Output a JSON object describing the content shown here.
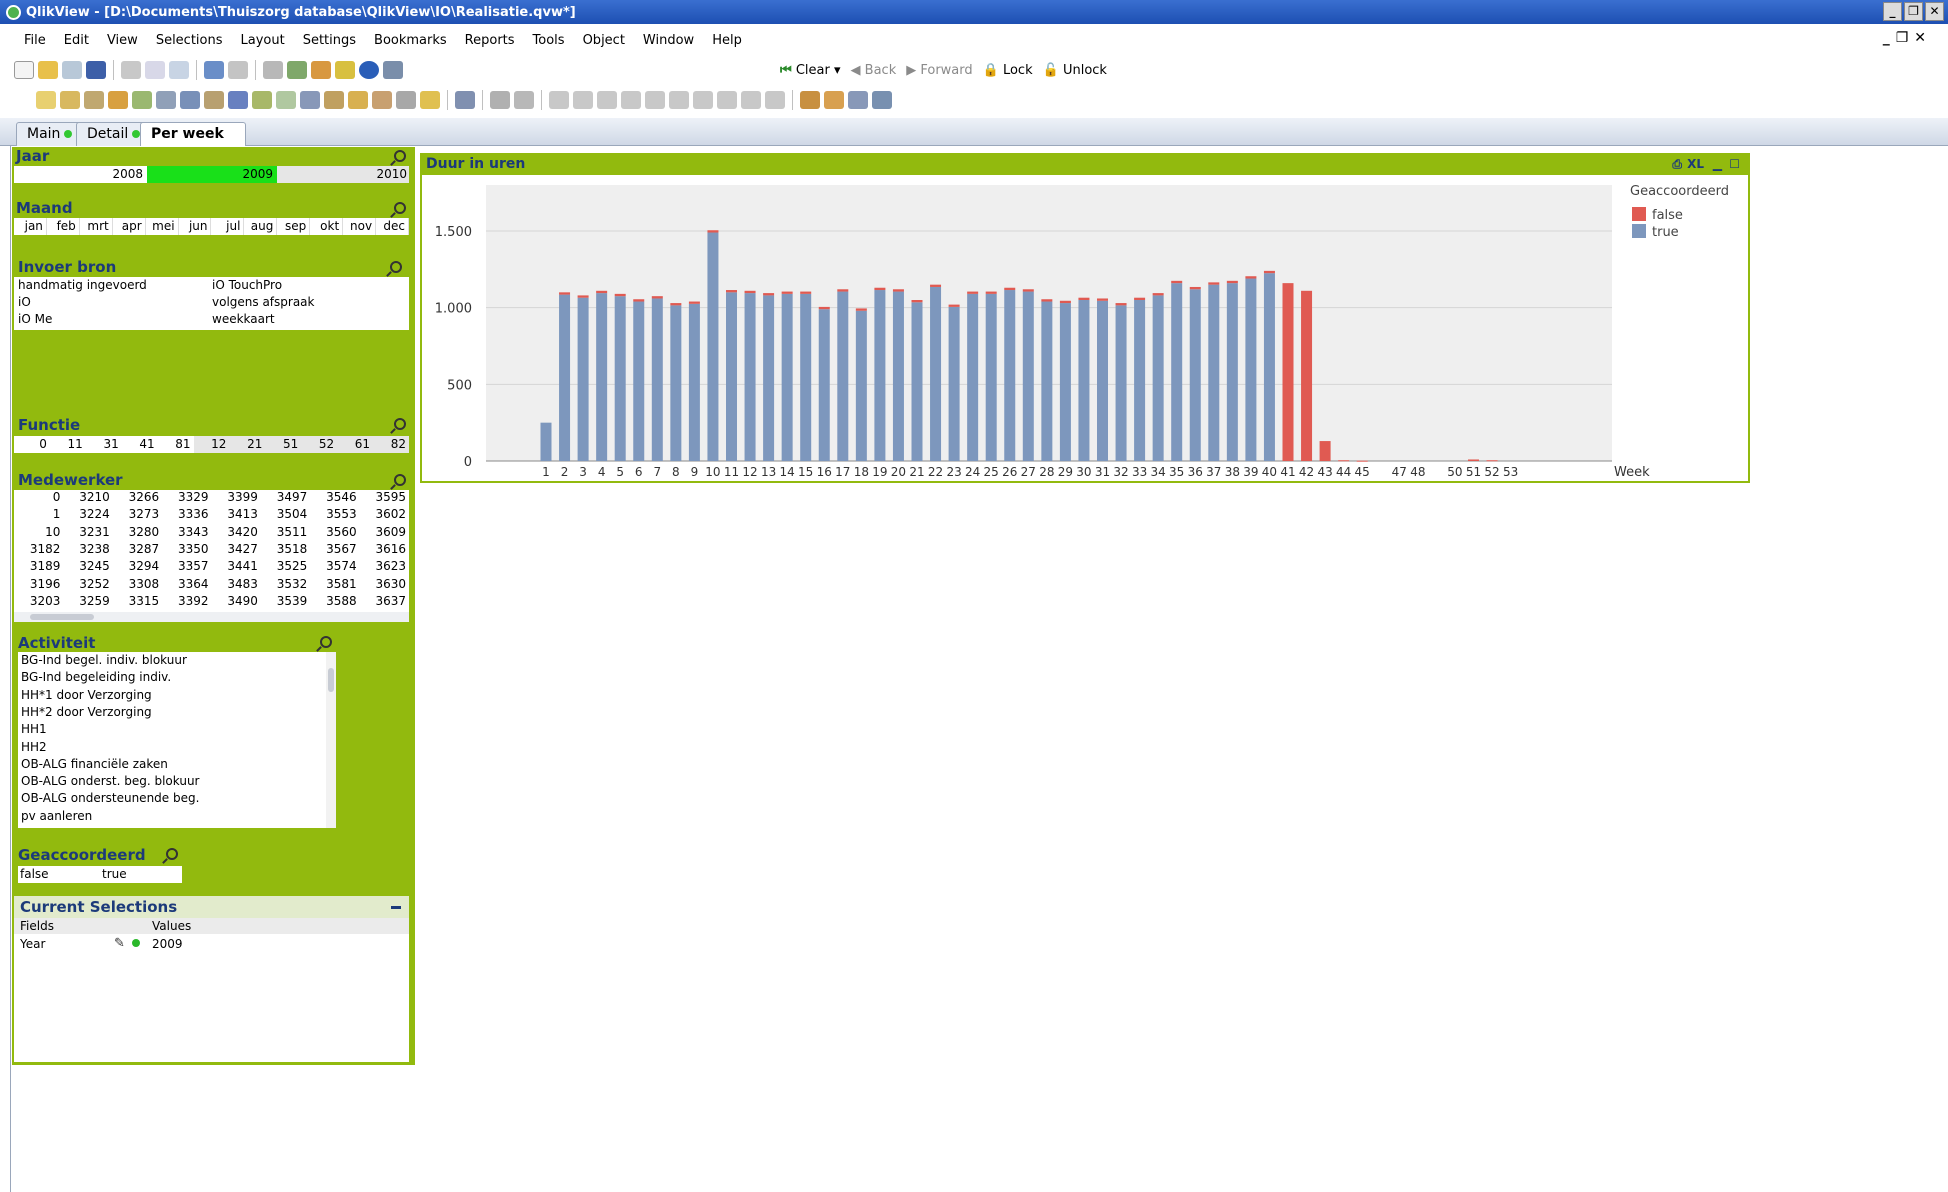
{
  "window": {
    "title": "QlikView - [D:\\Documents\\Thuiszorg database\\QlikView\\IO\\Realisatie.qvw*]"
  },
  "menu": [
    "File",
    "Edit",
    "View",
    "Selections",
    "Layout",
    "Settings",
    "Bookmarks",
    "Reports",
    "Tools",
    "Object",
    "Window",
    "Help"
  ],
  "toolbar": {
    "clear": "Clear",
    "back": "Back",
    "forward": "Forward",
    "lock": "Lock",
    "unlock": "Unlock"
  },
  "tabs": [
    {
      "label": "Main",
      "status_dot": true
    },
    {
      "label": "Detail",
      "status_dot": true
    },
    {
      "label": "Per week",
      "active": true
    }
  ],
  "listboxes": {
    "jaar": {
      "title": "Jaar",
      "values": [
        "2008",
        "2009",
        "2010"
      ],
      "selected": "2009"
    },
    "maand": {
      "title": "Maand",
      "values": [
        "jan",
        "feb",
        "mrt",
        "apr",
        "mei",
        "jun",
        "jul",
        "aug",
        "sep",
        "okt",
        "nov",
        "dec"
      ]
    },
    "invoer": {
      "title": "Invoer bron",
      "values": [
        "handmatig ingevoerd",
        "iO TouchPro",
        "iO",
        "volgens afspraak",
        "iO Me",
        "weekkaart"
      ]
    },
    "functie": {
      "title": "Functie",
      "values": [
        "0",
        "11",
        "31",
        "41",
        "81",
        "12",
        "21",
        "51",
        "52",
        "61",
        "82"
      ]
    },
    "medewerker": {
      "title": "Medewerker",
      "rows": [
        [
          "0",
          "3210",
          "3266",
          "3329",
          "3399",
          "3497",
          "3546",
          "3595"
        ],
        [
          "1",
          "3224",
          "3273",
          "3336",
          "3413",
          "3504",
          "3553",
          "3602"
        ],
        [
          "10",
          "3231",
          "3280",
          "3343",
          "3420",
          "3511",
          "3560",
          "3609"
        ],
        [
          "3182",
          "3238",
          "3287",
          "3350",
          "3427",
          "3518",
          "3567",
          "3616"
        ],
        [
          "3189",
          "3245",
          "3294",
          "3357",
          "3441",
          "3525",
          "3574",
          "3623"
        ],
        [
          "3196",
          "3252",
          "3308",
          "3364",
          "3483",
          "3532",
          "3581",
          "3630"
        ],
        [
          "3203",
          "3259",
          "3315",
          "3392",
          "3490",
          "3539",
          "3588",
          "3637"
        ]
      ]
    },
    "activiteit": {
      "title": "Activiteit",
      "values": [
        "BG-Ind begel. indiv. blokuur",
        "BG-Ind begeleiding indiv.",
        "HH*1 door Verzorging",
        "HH*2 door Verzorging",
        "HH1",
        "HH2",
        "OB-ALG financiële zaken",
        "OB-ALG onderst. beg. blokuur",
        "OB-ALG ondersteunende beg.",
        "pv aanleren"
      ]
    },
    "geaccoordeerd": {
      "title": "Geaccoordeerd",
      "values": [
        "false",
        "true"
      ]
    }
  },
  "current_selections": {
    "title": "Current Selections",
    "headers": {
      "fields": "Fields",
      "values": "Values"
    },
    "rows": [
      {
        "field": "Year",
        "value": "2009"
      }
    ]
  },
  "chart": {
    "caption": "Duur in uren",
    "caption_icons": [
      "print-icon",
      "xl-icon",
      "minimize-icon",
      "maximize-icon"
    ],
    "xl_label": "XL"
  },
  "colors": {
    "green": "#92ba0e",
    "false": "#e05a52",
    "true": "#7d97bd",
    "selected": "#19e019",
    "title": "#1c3a7a"
  },
  "chart_data": {
    "type": "bar",
    "title": "Duur in uren",
    "xlabel": "Week",
    "ylabel": "",
    "ylim": [
      0,
      1800
    ],
    "yticks": [
      "0",
      "500",
      "1.000",
      "1.500"
    ],
    "ytick_values": [
      0,
      500,
      1000,
      1500
    ],
    "legend": {
      "title": "Geaccoordeerd",
      "position": "top-right"
    },
    "categories": [
      "1",
      "2",
      "3",
      "4",
      "5",
      "6",
      "7",
      "8",
      "9",
      "10",
      "11",
      "12",
      "13",
      "14",
      "15",
      "16",
      "17",
      "18",
      "19",
      "20",
      "21",
      "22",
      "23",
      "24",
      "25",
      "26",
      "27",
      "28",
      "29",
      "30",
      "31",
      "32",
      "33",
      "34",
      "35",
      "36",
      "37",
      "38",
      "39",
      "40",
      "41",
      "42",
      "43",
      "44",
      "45",
      "47",
      "48",
      "50",
      "51",
      "52",
      "53"
    ],
    "series": [
      {
        "name": "false",
        "values": [
          0,
          15,
          15,
          15,
          15,
          15,
          15,
          15,
          15,
          15,
          15,
          15,
          15,
          15,
          15,
          15,
          15,
          15,
          15,
          15,
          15,
          15,
          15,
          15,
          15,
          15,
          15,
          15,
          15,
          15,
          15,
          15,
          15,
          15,
          15,
          15,
          15,
          15,
          15,
          15,
          1160,
          1110,
          130,
          5,
          2,
          0,
          0,
          0,
          10,
          5,
          0
        ]
      },
      {
        "name": "true",
        "values": [
          250,
          1085,
          1065,
          1095,
          1075,
          1040,
          1060,
          1015,
          1025,
          1490,
          1100,
          1095,
          1080,
          1090,
          1090,
          990,
          1105,
          980,
          1115,
          1105,
          1035,
          1135,
          1005,
          1090,
          1090,
          1115,
          1105,
          1040,
          1030,
          1050,
          1045,
          1015,
          1050,
          1080,
          1160,
          1120,
          1150,
          1160,
          1190,
          1225,
          0,
          0,
          0,
          0,
          0,
          0,
          0,
          0,
          0,
          0,
          0
        ]
      }
    ]
  }
}
